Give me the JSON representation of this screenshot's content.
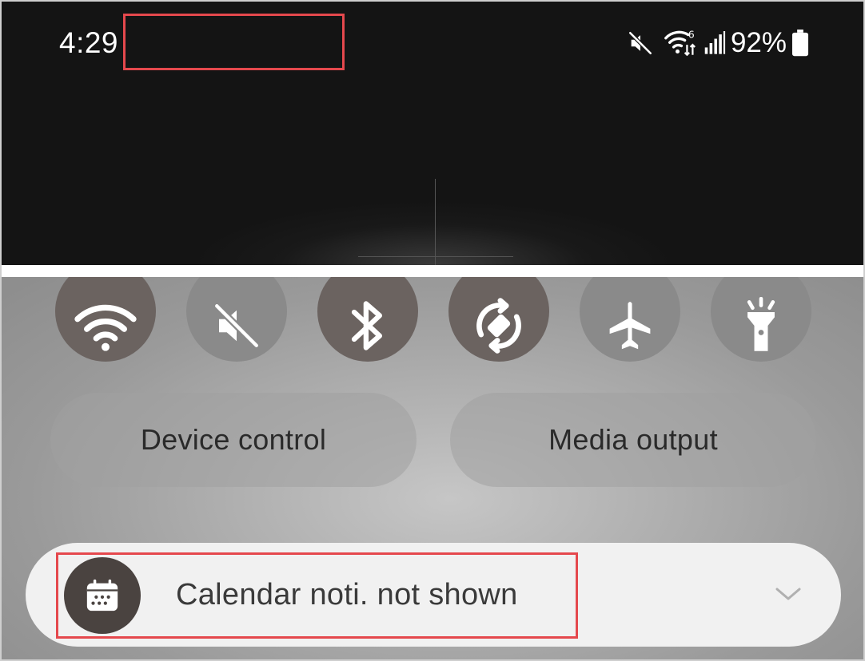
{
  "status_bar": {
    "time": "4:29",
    "battery_percent": "92%",
    "icons": [
      "mute-icon",
      "wifi-6-icon",
      "signal-icon",
      "battery-icon"
    ]
  },
  "quick_toggles": [
    {
      "name": "wifi",
      "icon": "wifi-icon",
      "state": "on"
    },
    {
      "name": "sound",
      "icon": "mute-icon",
      "state": "off"
    },
    {
      "name": "bluetooth",
      "icon": "bluetooth-icon",
      "state": "on"
    },
    {
      "name": "auto-rotate",
      "icon": "auto-rotate-icon",
      "state": "on"
    },
    {
      "name": "airplane-mode",
      "icon": "airplane-icon",
      "state": "off"
    },
    {
      "name": "flashlight",
      "icon": "flashlight-icon",
      "state": "off"
    }
  ],
  "buttons": {
    "device_control": "Device control",
    "media_output": "Media output"
  },
  "notification": {
    "icon": "calendar-icon",
    "text": "Calendar noti. not shown",
    "expand_icon": "chevron-down-icon"
  },
  "colors": {
    "highlight": "#e5484d",
    "toggle_on": "#6b6360",
    "toggle_off": "#8a8a8a",
    "status_bar_bg": "#141414"
  }
}
